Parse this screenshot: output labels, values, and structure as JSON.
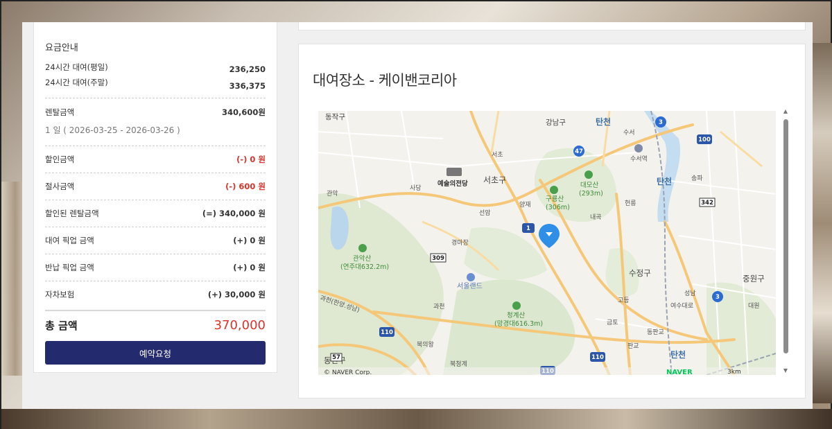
{
  "fee": {
    "title": "요금안내",
    "rate_weekday_label": "24시간 대여(평일)",
    "rate_weekday_value": "236,250",
    "rate_weekend_label": "24시간 대여(주말)",
    "rate_weekend_value": "336,375",
    "rental_label": "렌탈금액",
    "rental_value": "340,600원",
    "period": "1 일 ( 2026-03-25 - 2026-03-26 )",
    "discount_label": "할인금액",
    "discount_value": "(-) 0 원",
    "cut_label": "절사금액",
    "cut_value": "(-) 600 원",
    "discounted_label": "할인된 렌탈금액",
    "discounted_value": "(=) 340,000 원",
    "pickup_label": "대여 픽업 금액",
    "pickup_value": "(+) 0 원",
    "return_label": "반납 픽업 금액",
    "return_value": "(+) 0 원",
    "insurance_label": "자차보험",
    "insurance_value": "(+) 30,000 원",
    "total_label": "총 금액",
    "total_value": "370,000",
    "reserve_button": "예약요청"
  },
  "map": {
    "title": "대여장소 - 케이밴코리아",
    "copyright": "© NAVER Corp.",
    "brand": "NAVER",
    "scale": "3km",
    "labels": {
      "dongjak": "동작구",
      "gangnam": "강남구",
      "tancheon_top": "탄천",
      "suseo_ic": "수서",
      "seocho_ic": "서초",
      "suseo_station": "수서역",
      "arts_center": "예술의전당",
      "seocho_gu": "서초구",
      "gwanak_ic": "관악",
      "sadang": "사당",
      "yangjae": "양재",
      "guryongsan": "구룡산",
      "guryongsan_h": "(306m)",
      "daemosan": "대모산",
      "daemosan_h": "(293m)",
      "heolleung": "헌릉",
      "songpa": "송파",
      "tancheon_mid": "탄천",
      "seonam": "선암",
      "naegok": "내곡",
      "gyeongmajang": "경마장",
      "gwanaksan": "관악산",
      "gwanaksan_h": "(연주대632.2m)",
      "seoul_land": "서울랜드",
      "sujeong": "수정구",
      "jungwon": "중원구",
      "gwacheon": "과천",
      "cheonggyesan": "청계산",
      "cheonggyesan_h": "(망경대616.3m)",
      "godeung": "고등",
      "seongnam": "성남",
      "yeosu": "여수대로",
      "daewon": "대원",
      "geumto": "금토",
      "dongpangyo": "동판교",
      "bugeuiwang": "북의왕",
      "pangyo": "판교",
      "dongan": "동안구",
      "bukcheonggye": "북청계",
      "tancheon_bottom": "탄천",
      "road_1": "1",
      "road_47": "47",
      "road_3a": "3",
      "road_3b": "3",
      "road_100": "100",
      "road_342": "342",
      "road_309": "309",
      "road_110a": "110",
      "road_110b": "110",
      "road_110c": "110",
      "road_57": "57",
      "gwacheon_road": "과천(한양.성남)"
    }
  }
}
